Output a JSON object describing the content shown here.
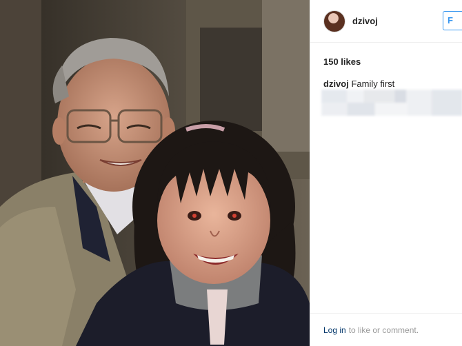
{
  "post": {
    "username": "dzivoj",
    "follow_label": "F",
    "likes": "150 likes",
    "caption_user": "dzivoj",
    "caption_text": "Family first",
    "footer_login": "Log in",
    "footer_rest": "to like or comment."
  },
  "icons": {
    "avatar": "profile-avatar",
    "photo": "family-photo"
  },
  "colors": {
    "follow_blue": "#3897f0",
    "login_link": "#003569",
    "border": "#efefef"
  }
}
